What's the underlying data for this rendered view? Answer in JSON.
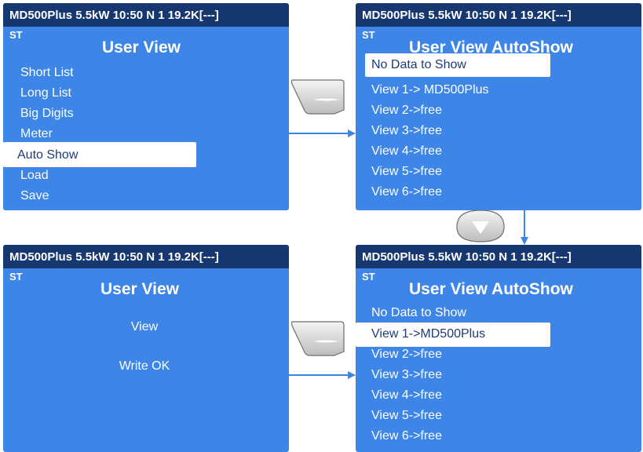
{
  "header_text": "MD500Plus  5.5kW  10:50  N  1 19.2K[---]",
  "status_tag": "ST",
  "screen1": {
    "title": "User View",
    "items": [
      "Short List",
      "Long List",
      "Big Digits",
      "Meter",
      "Auto Show",
      "Load",
      "Save"
    ],
    "selected_index": 4
  },
  "screen2": {
    "title": "User View AutoShow",
    "items": [
      "No Data to Show",
      "View 1-> MD500Plus",
      "View 2->free",
      "View 3->free",
      "View 4->free",
      "View 5->free",
      "View 6->free"
    ],
    "selected_index": 0
  },
  "screen3": {
    "title": "User View",
    "line1": "View",
    "line2": "Write OK"
  },
  "screen4": {
    "title": "User View AutoShow",
    "items": [
      "No Data to Show",
      "View 1->MD500Plus",
      "View 2->free",
      "View 3->free",
      "View 4->free",
      "View 5->free",
      "View 6->free"
    ],
    "selected_index": 1
  },
  "icons": [
    "enter-key-icon",
    "down-arrow-key-icon",
    "enter-key-icon"
  ]
}
